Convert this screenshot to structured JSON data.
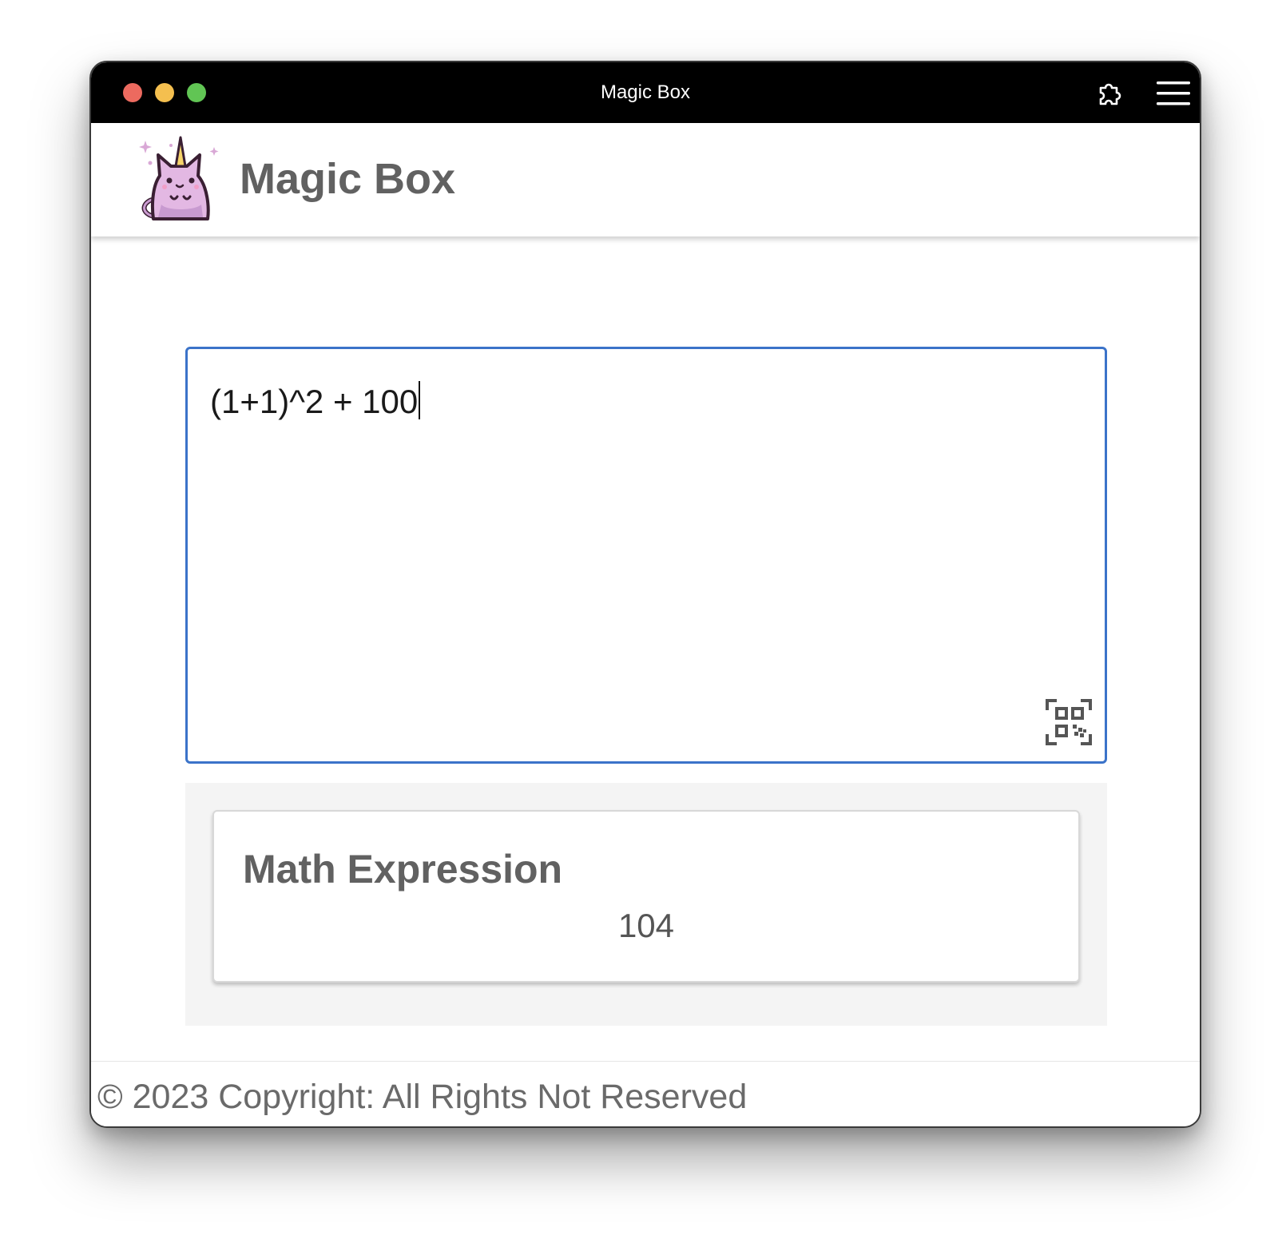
{
  "window": {
    "title": "Magic Box",
    "controls": [
      "close",
      "minimize",
      "maximize"
    ],
    "toolbar_icons": [
      "extension-puzzle-icon",
      "hamburger-menu-icon"
    ]
  },
  "header": {
    "app_title": "Magic Box",
    "logo": "unicorn-cat-logo"
  },
  "editor": {
    "value": "(1+1)^2 + 100",
    "border_color": "#3b73c9",
    "action_icon": "qr-code-scan-icon"
  },
  "results": [
    {
      "title": "Math Expression",
      "value": "104"
    }
  ],
  "footer": {
    "text": "© 2023 Copyright: All Rights Not Reserved"
  },
  "colors": {
    "title_bar": "#000000",
    "close": "#ec6a5f",
    "minimize": "#f4bf4f",
    "maximize": "#61c554",
    "heading_text": "#616161",
    "accent_border": "#3b73c9",
    "results_background": "#f4f4f4"
  }
}
